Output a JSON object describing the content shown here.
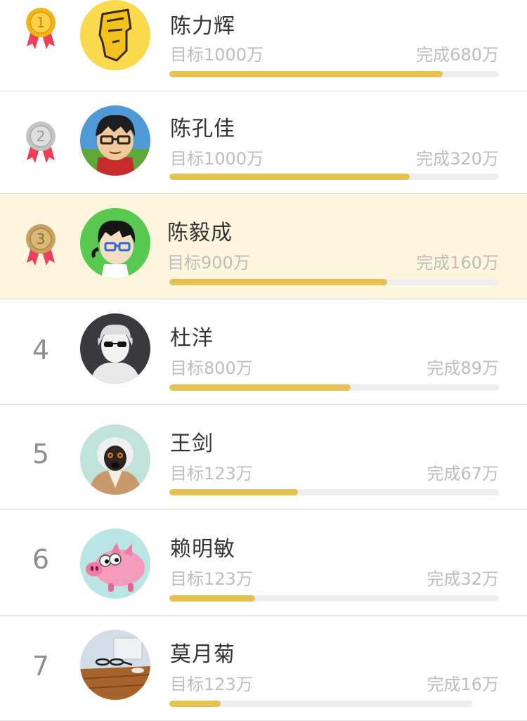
{
  "colors": {
    "accent": "#e6c14f",
    "track": "#eeeeee",
    "highlight_row": "#fdf5de",
    "medal_ribbon": "#ec3f5a"
  },
  "rankings": [
    {
      "rank": "1",
      "medal": "gold",
      "name": "陈力辉",
      "target": "目标1000万",
      "done": "完成680万",
      "progress": 0.83,
      "avatar_icon": "cartoon-helmet-avatar-icon"
    },
    {
      "rank": "2",
      "medal": "silver",
      "name": "陈孔佳",
      "target": "目标1000万",
      "done": "完成320万",
      "progress": 0.73,
      "avatar_icon": "cartoon-glasses-man-avatar-icon"
    },
    {
      "rank": "3",
      "medal": "bronze",
      "name": "陈毅成",
      "target": "目标900万",
      "done": "完成160万",
      "progress": 0.66,
      "avatar_icon": "cartoon-boy-avatar-icon",
      "highlighted": true
    },
    {
      "rank": "4",
      "medal": null,
      "name": "杜洋",
      "target": "目标800万",
      "done": "完成89万",
      "progress": 0.55,
      "avatar_icon": "statue-sunglasses-avatar-icon"
    },
    {
      "rank": "5",
      "medal": null,
      "name": "王剑",
      "target": "目标123万",
      "done": "完成67万",
      "progress": 0.39,
      "avatar_icon": "monkey-avatar-icon"
    },
    {
      "rank": "6",
      "medal": null,
      "name": "赖明敏",
      "target": "目标123万",
      "done": "完成32万",
      "progress": 0.26,
      "avatar_icon": "pig-avatar-icon"
    },
    {
      "rank": "7",
      "medal": null,
      "name": "莫月菊",
      "target": "目标123万",
      "done": "完成16万",
      "progress": 0.17,
      "avatar_icon": "desk-glasses-avatar-icon"
    }
  ]
}
